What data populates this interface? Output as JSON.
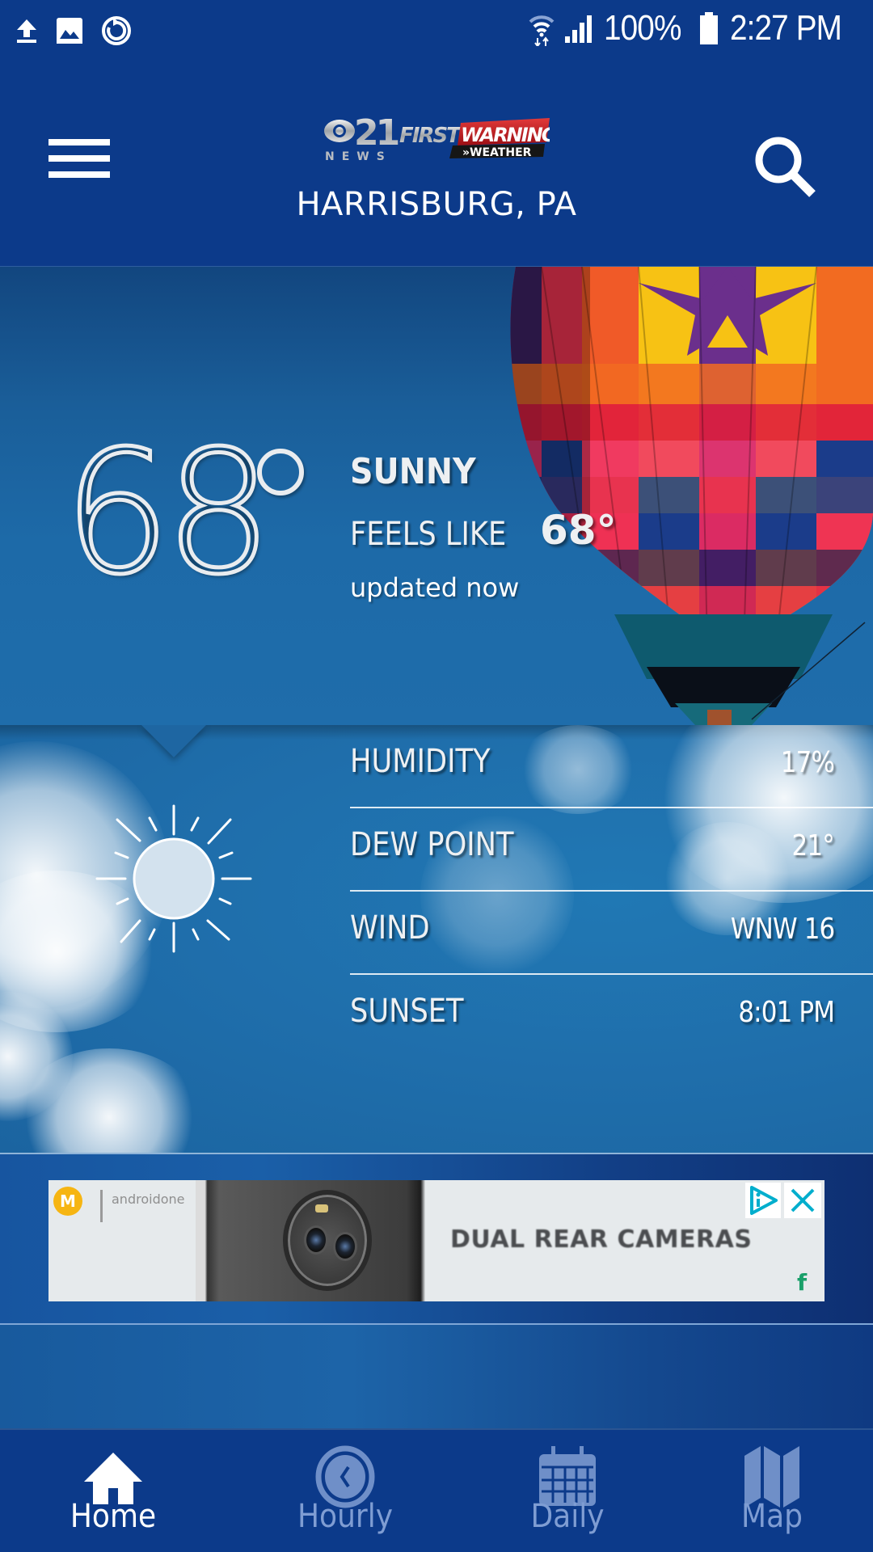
{
  "status_bar": {
    "left_icons": [
      "upload-icon",
      "image-icon",
      "sync-icon"
    ],
    "wifi_icon": "wifi-data-icon",
    "signal_icon": "signal-icon",
    "battery_percent": "100%",
    "battery_icon": "battery-full-icon",
    "time": "2:27 PM"
  },
  "header": {
    "menu_icon": "hamburger-menu-icon",
    "logo": {
      "station": "21",
      "station_sub": "NEWS",
      "brand_first": "FIRST",
      "brand_warning": "WARNING",
      "brand_weather": "»WEATHER"
    },
    "location": "HARRISBURG, PA",
    "search_icon": "search-icon"
  },
  "current": {
    "temperature": "68",
    "condition": "SUNNY",
    "feels_like_label": "FEELS LIKE",
    "feels_like_value": "68°",
    "updated": "updated now",
    "background": "hot-air-balloon-photo"
  },
  "details": {
    "condition_icon": "sun-icon",
    "rows": [
      {
        "label": "HUMIDITY",
        "value": "17%"
      },
      {
        "label": "DEW POINT",
        "value": "21°"
      },
      {
        "label": "WIND",
        "value": "WNW 16"
      },
      {
        "label": "SUNSET",
        "value": "8:01 PM"
      }
    ]
  },
  "ad": {
    "brand": "androidone",
    "headline": "DUAL REAR CAMERAS",
    "adchoices_icon": "adchoices-icon",
    "close_icon": "close-icon",
    "advertiser_icon": "google-fi-icon",
    "advertiser_mark": "f",
    "colors": {
      "logo": "#f6b512",
      "adchoices": "#00aecd",
      "fi": "#1aa06a"
    }
  },
  "bottom_nav": {
    "items": [
      {
        "label": "Home",
        "icon": "home-icon",
        "active": true
      },
      {
        "label": "Hourly",
        "icon": "clock-icon",
        "active": false
      },
      {
        "label": "Daily",
        "icon": "calendar-icon",
        "active": false
      },
      {
        "label": "Map",
        "icon": "map-icon",
        "active": false
      }
    ]
  },
  "colors": {
    "header_bg": "#0c3a8a",
    "sky": "#1f6dab",
    "nav_active": "#ffffff",
    "nav_inactive": "#7f9dd3"
  }
}
